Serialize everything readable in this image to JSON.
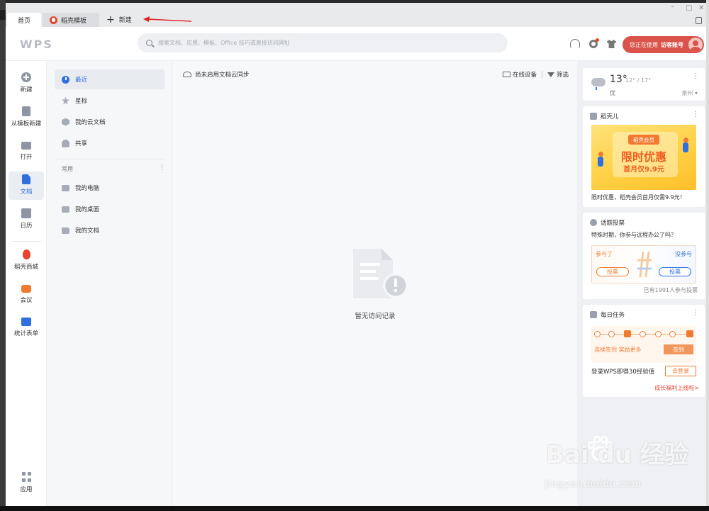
{
  "tabs": {
    "home": "首页",
    "template": "稻壳模板",
    "new": "新建"
  },
  "header": {
    "logo": "WPS",
    "search_placeholder": "搜索文档、应用、模板、Office 技巧或直接访问网址",
    "account_prefix": "您正在使用",
    "account_name": "访客账号"
  },
  "leftbar": {
    "items": [
      {
        "label": "新建",
        "icon": "plus-circle-icon"
      },
      {
        "label": "从模板新建",
        "icon": "template-icon"
      },
      {
        "label": "打开",
        "icon": "folder-icon"
      },
      {
        "label": "文档",
        "icon": "document-icon",
        "active": true
      },
      {
        "label": "日历",
        "icon": "calendar-icon"
      },
      {
        "label": "稻壳商城",
        "icon": "docer-mall-icon"
      },
      {
        "label": "会议",
        "icon": "meeting-icon"
      },
      {
        "label": "统计表单",
        "icon": "form-icon"
      },
      {
        "label": "应用",
        "icon": "apps-icon"
      }
    ]
  },
  "nav": {
    "items": [
      {
        "label": "最近",
        "icon": "clock-icon",
        "active": true
      },
      {
        "label": "星标",
        "icon": "star-icon"
      },
      {
        "label": "我的云文档",
        "icon": "cloud-doc-icon"
      },
      {
        "label": "共享",
        "icon": "share-icon"
      }
    ],
    "section": "常用",
    "common": [
      {
        "label": "我的电脑",
        "icon": "computer-icon"
      },
      {
        "label": "我的桌面",
        "icon": "desktop-icon"
      },
      {
        "label": "我的文档",
        "icon": "folder-doc-icon"
      }
    ]
  },
  "main": {
    "sync_notice": "尚未启用文档云同步",
    "online_devices": "在线设备",
    "filter": "筛选",
    "empty_text": "暂无访问记录"
  },
  "weather": {
    "temp": "13°",
    "range": "12° / 17°",
    "aqi": "优",
    "city": "泉州 ▾"
  },
  "promo": {
    "title": "稻壳儿",
    "badge": "稻壳会员",
    "banner_title": "限时优惠",
    "banner_sub": "首月仅9.9元",
    "caption": "限时优惠，稻壳会员首月仅需9.9元！"
  },
  "poll": {
    "title": "话题投票",
    "question": "特殊时期，你参与远程办公了吗？",
    "option_left": "参与了",
    "option_right": "没参与",
    "vote_label": "投票",
    "count": "已有1991人参与投票"
  },
  "tasks": {
    "title": "每日任务",
    "signin_text": "连续签到 奖励更多",
    "signin_button": "签到",
    "login_text": "登录WPS即得30经验值",
    "login_button": "去登录",
    "growth_link": "成长福利上线啦>"
  },
  "watermark": {
    "main": "Bai du 经验",
    "sub": "jingyan.baidu.com"
  },
  "colors": {
    "accent": "#2f6fe0",
    "brand_red": "#d9534a",
    "orange": "#f07a30"
  }
}
